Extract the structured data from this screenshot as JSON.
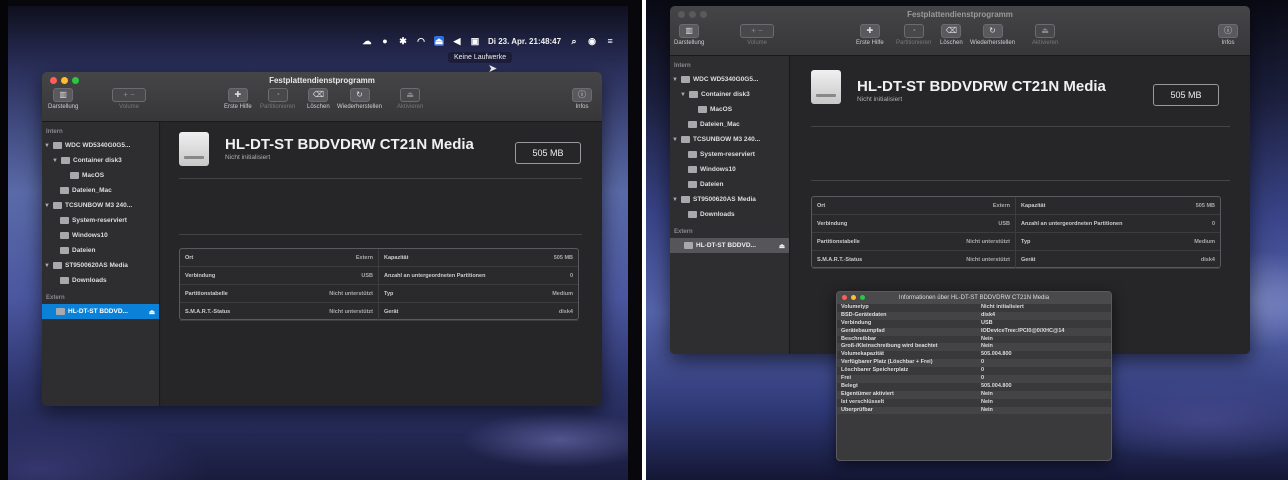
{
  "menubar": {
    "datetime": "Di 23. Apr. 21:48:47",
    "tooltip": "Keine Laufwerke"
  },
  "window": {
    "title": "Festplattendienstprogramm",
    "toolbar": {
      "view_label": "Darstellung",
      "volume_label": "Volume",
      "first_aid": "Erste Hilfe",
      "partition": "Partitionieren",
      "erase": "Löschen",
      "restore": "Wiederherstellen",
      "unmount": "Aktivieren",
      "info": "Infos"
    },
    "sidebar": {
      "internal_header": "Intern",
      "external_header": "Extern",
      "items": [
        "WDC WD5340G0G5...",
        "Container disk3",
        "MacOS",
        "Dateien_Mac",
        "TCSUNBOW M3 240...",
        "System-reserviert",
        "Windows10",
        "Dateien",
        "ST9500620AS Media",
        "Downloads",
        "HL-DT-ST BDDVD..."
      ]
    },
    "drive": {
      "name": "HL-DT-ST BDDVDRW CT21N Media",
      "status": "Nicht initialisiert",
      "size": "505 MB"
    },
    "info": [
      {
        "label": "Ort",
        "value": "Extern",
        "label2": "Kapazität",
        "value2": "505 MB"
      },
      {
        "label": "Verbindung",
        "value": "USB",
        "label2": "Anzahl an untergeordneten Partitionen",
        "value2": "0"
      },
      {
        "label": "Partitionstabelle",
        "value": "Nicht unterstützt",
        "label2": "Typ",
        "value2": "Medium"
      },
      {
        "label": "S.M.A.R.T.-Status",
        "value": "Nicht unterstützt",
        "label2": "Gerät",
        "value2": "disk4"
      }
    ]
  },
  "popup": {
    "title": "Informationen über HL-DT-ST BDDVDRW CT21N Media",
    "rows": [
      [
        "Volumetyp",
        "Nicht initialisiert"
      ],
      [
        "BSD-Gerätedaten",
        "disk4"
      ],
      [
        "Verbindung",
        "USB"
      ],
      [
        "Gerätebaumpfad",
        "IODeviceTree:/PCI0@0/XHC@14"
      ],
      [
        "Beschreibbar",
        "Nein"
      ],
      [
        "Groß-/Kleinschreibung wird beachtet",
        "Nein"
      ],
      [
        "Volumekapazität",
        "505.004.800"
      ],
      [
        "Verfügbarer Platz (Löschbar + Frei)",
        "0"
      ],
      [
        "Löschbarer Speicherplatz",
        "0"
      ],
      [
        "Frei",
        "0"
      ],
      [
        "Belegt",
        "505.004.800"
      ],
      [
        "Eigentümer aktiviert",
        "Nein"
      ],
      [
        "Ist verschlüsselt",
        "Nein"
      ],
      [
        "Überprüfbar",
        "Nein"
      ]
    ]
  },
  "colors": {
    "selection": "#0b82d8",
    "window_bg": "#242426",
    "sidebar_bg": "#2e2e31"
  }
}
